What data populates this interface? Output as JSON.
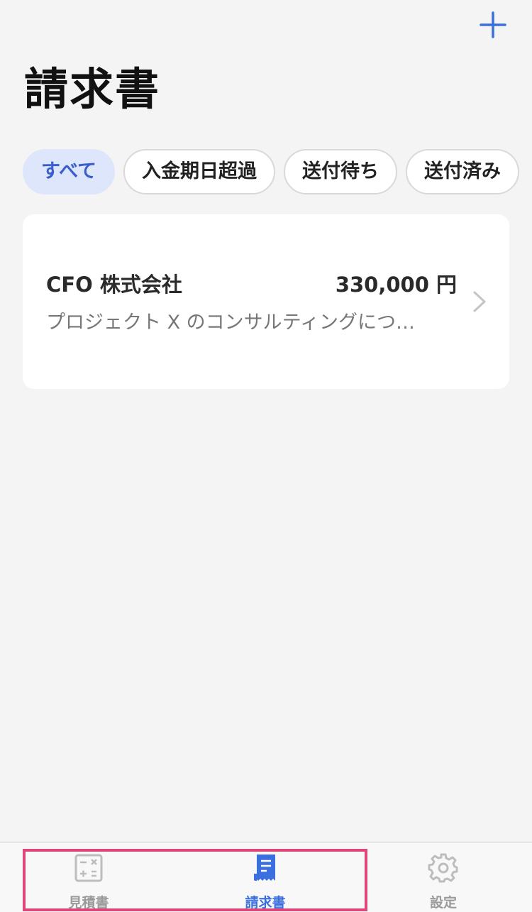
{
  "header": {
    "title": "請求書",
    "add_icon": "plus-icon"
  },
  "filters": {
    "items": [
      {
        "label": "すべて",
        "active": true
      },
      {
        "label": "入金期日超過",
        "active": false
      },
      {
        "label": "送付待ち",
        "active": false
      },
      {
        "label": "送付済み",
        "active": false
      }
    ]
  },
  "invoices": [
    {
      "client": "CFO 株式会社",
      "amount": "330,000 円",
      "description": "プロジェクト X のコンサルティングにつ…"
    }
  ],
  "tabbar": {
    "items": [
      {
        "label": "見積書",
        "icon": "calculator-icon",
        "active": false
      },
      {
        "label": "請求書",
        "icon": "receipt-icon",
        "active": true
      },
      {
        "label": "設定",
        "icon": "gear-icon",
        "active": false
      }
    ]
  },
  "colors": {
    "accent": "#3b6fe0",
    "background": "#f4f4f4",
    "highlight": "#e0457b"
  }
}
